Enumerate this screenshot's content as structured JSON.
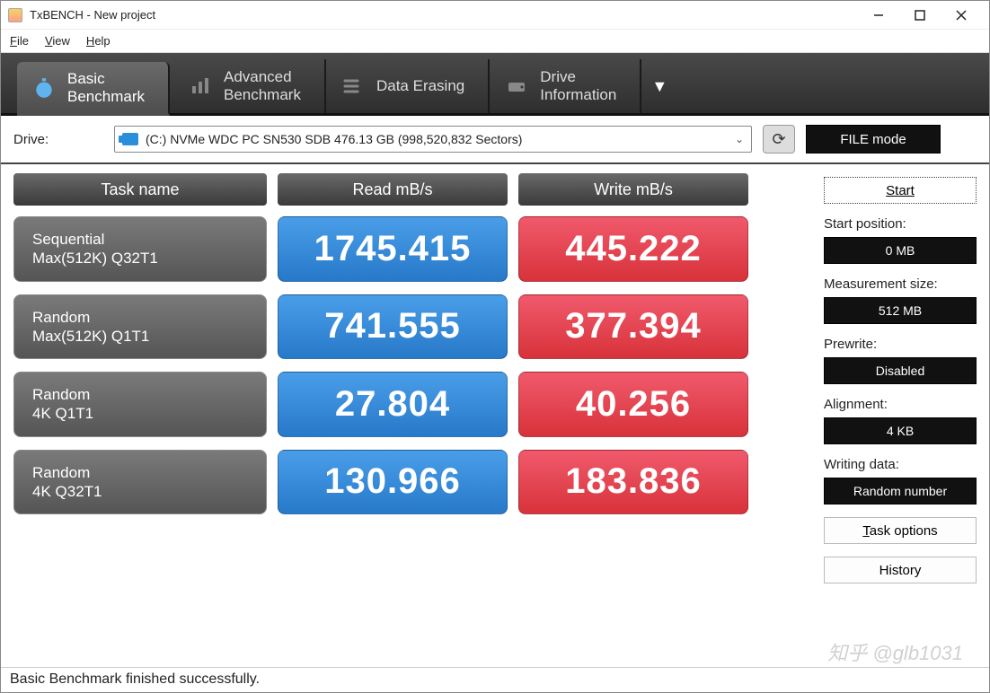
{
  "window": {
    "title": "TxBENCH - New project"
  },
  "menu": {
    "file": "File",
    "view": "View",
    "help": "Help"
  },
  "tabs": {
    "basic": "Basic\nBenchmark",
    "advanced": "Advanced\nBenchmark",
    "erasing": "Data Erasing",
    "drive": "Drive\nInformation"
  },
  "drive": {
    "label": "Drive:",
    "value": "(C:) NVMe WDC PC SN530 SDB  476.13 GB (998,520,832 Sectors)"
  },
  "filemode": "FILE mode",
  "headers": {
    "task": "Task name",
    "read": "Read mB/s",
    "write": "Write mB/s"
  },
  "rows": [
    {
      "name1": "Sequential",
      "name2": "Max(512K) Q32T1",
      "read": "1745.415",
      "write": "445.222"
    },
    {
      "name1": "Random",
      "name2": "Max(512K) Q1T1",
      "read": "741.555",
      "write": "377.394"
    },
    {
      "name1": "Random",
      "name2": "4K Q1T1",
      "read": "27.804",
      "write": "40.256"
    },
    {
      "name1": "Random",
      "name2": "4K Q32T1",
      "read": "130.966",
      "write": "183.836"
    }
  ],
  "side": {
    "start": "Start",
    "startpos_label": "Start position:",
    "startpos": "0 MB",
    "msize_label": "Measurement size:",
    "msize": "512 MB",
    "prewrite_label": "Prewrite:",
    "prewrite": "Disabled",
    "align_label": "Alignment:",
    "align": "4 KB",
    "wdata_label": "Writing data:",
    "wdata": "Random number",
    "taskopt": "Task options",
    "history": "History"
  },
  "status": "Basic Benchmark finished successfully.",
  "watermark": "知乎 @glb1031"
}
